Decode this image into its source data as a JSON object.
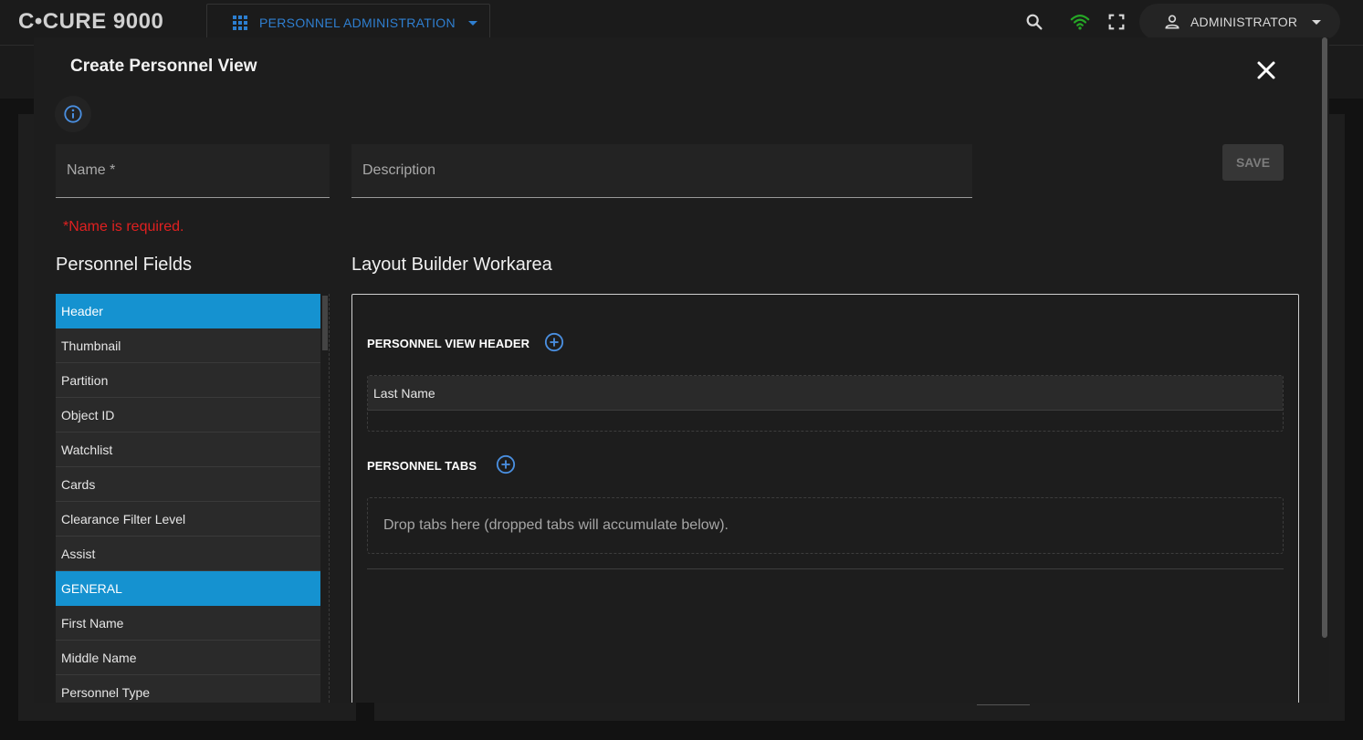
{
  "app": {
    "title": "C•CURE 9000"
  },
  "topbar": {
    "module": "PERSONNEL ADMINISTRATION",
    "user": "ADMINISTRATOR",
    "icons": [
      "search-icon",
      "wifi-icon",
      "fullscreen-icon",
      "person-icon"
    ],
    "accent": "#2f7fd0",
    "wifi_color": "#26a626"
  },
  "modal": {
    "title": "Create Personnel View",
    "name_placeholder": "Name *",
    "description_placeholder": "Description",
    "save_label": "SAVE",
    "error": "*Name is required.",
    "personnel_fields_heading": "Personnel Fields",
    "workarea_heading": "Layout Builder Workarea",
    "fields": [
      {
        "label": "Header",
        "highlight": true
      },
      {
        "label": "Thumbnail",
        "highlight": false
      },
      {
        "label": "Partition",
        "highlight": false
      },
      {
        "label": "Object ID",
        "highlight": false
      },
      {
        "label": "Watchlist",
        "highlight": false
      },
      {
        "label": "Cards",
        "highlight": false
      },
      {
        "label": "Clearance Filter Level",
        "highlight": false
      },
      {
        "label": "Assist",
        "highlight": false
      },
      {
        "label": "GENERAL",
        "highlight": true
      },
      {
        "label": "First Name",
        "highlight": false
      },
      {
        "label": "Middle Name",
        "highlight": false
      },
      {
        "label": "Personnel Type",
        "highlight": false
      }
    ],
    "workarea": {
      "header_label": "PERSONNEL VIEW HEADER",
      "header_items": [
        "Last Name"
      ],
      "tabs_label": "PERSONNEL TABS",
      "tabs_placeholder": "Drop tabs here (dropped tabs will accumulate below)."
    },
    "highlight_color": "#1592d0",
    "error_color": "#e02020"
  }
}
